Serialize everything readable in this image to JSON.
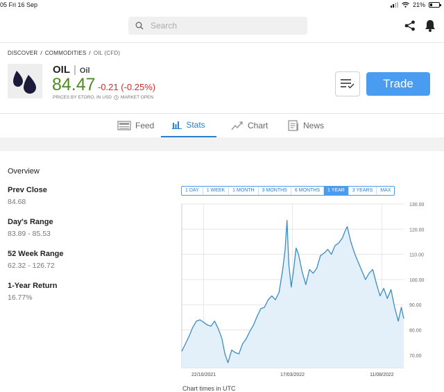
{
  "status_bar": {
    "time": "05   Fri 16 Sep",
    "battery": "21%",
    "battery_level": 0.21
  },
  "search": {
    "placeholder": "Search"
  },
  "breadcrumb": [
    {
      "label": "DISCOVER"
    },
    {
      "label": "COMMODITIES"
    },
    {
      "label": "OIL (CFD)"
    }
  ],
  "instrument": {
    "symbol": "OIL",
    "name": "Oil",
    "price": "84.47",
    "change": "-0.21 (-0.25%)",
    "prices_by": "PRICES BY ETORO, IN USD",
    "market_status": "MARKET OPEN"
  },
  "actions": {
    "trade_label": "Trade"
  },
  "tabs": [
    {
      "label": "Feed"
    },
    {
      "label": "Stats"
    },
    {
      "label": "Chart"
    },
    {
      "label": "News"
    }
  ],
  "colors": {
    "accent": "#4a9cf0",
    "price_up": "#4d8a26",
    "change_down": "#c9302c",
    "line": "#3a8cc4"
  },
  "overview": {
    "title": "Overview",
    "stats": [
      {
        "label": "Prev Close",
        "value": "84.68"
      },
      {
        "label": "Day's Range",
        "value": "83.89 - 85.53"
      },
      {
        "label": "52 Week Range",
        "value": "62.32 - 126.72"
      },
      {
        "label": "1-Year Return",
        "value": "16.77%"
      }
    ]
  },
  "time_ranges": [
    "1 DAY",
    "1 WEEK",
    "1 MONTH",
    "3 MONTHS",
    "6 MONTHS",
    "1 YEAR",
    "3 YEARS",
    "MAX"
  ],
  "selected_range": "1 YEAR",
  "chart_footer": "Chart times in UTC",
  "chart_data": {
    "type": "area",
    "title": "",
    "xlabel": "",
    "ylabel": "",
    "x_range": [
      "2021-09-16",
      "2022-09-16"
    ],
    "ylim": [
      65,
      130
    ],
    "y_ticks": [
      "70.00",
      "80.00",
      "90.00",
      "100.00",
      "110.00",
      "120.00",
      "130.00"
    ],
    "y_tick_values": [
      70,
      80,
      90,
      100,
      110,
      120,
      130
    ],
    "x_ticks": [
      {
        "date": "2021-10-22",
        "label": "22/10/2021"
      },
      {
        "date": "2022-03-17",
        "label": "17/03/2022"
      },
      {
        "date": "2022-08-11",
        "label": "11/08/2022"
      }
    ],
    "grid": true,
    "series": [
      {
        "x": [
          "2021-09-16",
          "2021-09-22",
          "2021-09-28",
          "2021-10-04",
          "2021-10-10",
          "2021-10-16",
          "2021-10-22",
          "2021-10-28",
          "2021-11-03",
          "2021-11-09",
          "2021-11-15",
          "2021-11-21",
          "2021-11-26",
          "2021-12-01",
          "2021-12-07",
          "2021-12-13",
          "2021-12-19",
          "2021-12-25",
          "2021-12-31",
          "2022-01-06",
          "2022-01-12",
          "2022-01-18",
          "2022-01-24",
          "2022-01-30",
          "2022-02-05",
          "2022-02-11",
          "2022-02-17",
          "2022-02-23",
          "2022-03-01",
          "2022-03-05",
          "2022-03-08",
          "2022-03-11",
          "2022-03-15",
          "2022-03-19",
          "2022-03-23",
          "2022-03-27",
          "2022-04-02",
          "2022-04-08",
          "2022-04-14",
          "2022-04-20",
          "2022-04-26",
          "2022-05-02",
          "2022-05-08",
          "2022-05-14",
          "2022-05-20",
          "2022-05-26",
          "2022-06-01",
          "2022-06-07",
          "2022-06-11",
          "2022-06-15",
          "2022-06-21",
          "2022-06-27",
          "2022-07-03",
          "2022-07-09",
          "2022-07-15",
          "2022-07-21",
          "2022-07-27",
          "2022-08-02",
          "2022-08-08",
          "2022-08-14",
          "2022-08-20",
          "2022-08-26",
          "2022-09-01",
          "2022-09-07",
          "2022-09-12",
          "2022-09-16"
        ],
        "values": [
          71.5,
          74.5,
          77.5,
          81.0,
          83.5,
          84.0,
          83.0,
          82.0,
          81.5,
          83.5,
          80.5,
          76.5,
          70.5,
          67.0,
          72.0,
          71.0,
          70.5,
          74.5,
          76.5,
          79.5,
          82.0,
          85.5,
          88.5,
          89.0,
          92.0,
          93.5,
          92.0,
          95.0,
          104.0,
          112.0,
          123.5,
          106.0,
          97.0,
          104.0,
          112.5,
          110.0,
          103.0,
          98.0,
          104.0,
          102.5,
          104.5,
          109.5,
          110.5,
          112.0,
          110.0,
          113.5,
          114.5,
          116.5,
          119.0,
          121.0,
          115.0,
          110.5,
          107.0,
          103.5,
          100.0,
          102.5,
          104.0,
          98.5,
          93.5,
          96.5,
          92.5,
          96.0,
          89.0,
          83.5,
          89.0,
          84.5
        ]
      }
    ]
  }
}
